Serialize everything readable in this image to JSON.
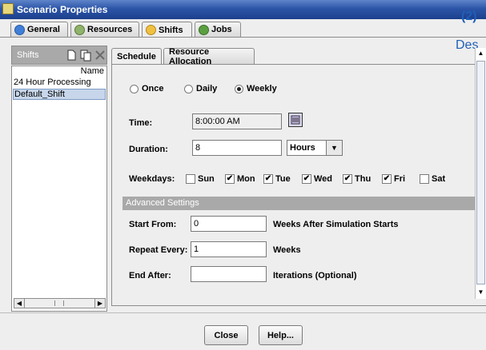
{
  "window": {
    "title": "Scenario Properties"
  },
  "overlay": {
    "number": "(2)",
    "partial_text": "Des"
  },
  "tabs": [
    {
      "label": "General"
    },
    {
      "label": "Resources"
    },
    {
      "label": "Shifts"
    },
    {
      "label": "Jobs"
    }
  ],
  "shifts_panel": {
    "header": "Shifts",
    "column_header": "Name",
    "items": [
      "24 Hour Processing",
      "Default_Shift"
    ]
  },
  "sub_tabs": [
    {
      "label": "Schedule"
    },
    {
      "label": "Resource Allocation"
    }
  ],
  "schedule": {
    "frequency_options": [
      "Once",
      "Daily",
      "Weekly"
    ],
    "selected_frequency": "Weekly",
    "time_label": "Time:",
    "time_value": "8:00:00 AM",
    "duration_label": "Duration:",
    "duration_value": "8",
    "duration_unit": "Hours",
    "weekdays_label": "Weekdays:",
    "weekdays": [
      {
        "label": "Sun",
        "checked": false
      },
      {
        "label": "Mon",
        "checked": true
      },
      {
        "label": "Tue",
        "checked": true
      },
      {
        "label": "Wed",
        "checked": true
      },
      {
        "label": "Thu",
        "checked": true
      },
      {
        "label": "Fri",
        "checked": true
      },
      {
        "label": "Sat",
        "checked": false
      }
    ]
  },
  "advanced": {
    "header": "Advanced Settings",
    "start_from_label": "Start From:",
    "start_from_value": "0",
    "start_from_suffix": "Weeks After Simulation Starts",
    "repeat_every_label": "Repeat Every:",
    "repeat_every_value": "1",
    "repeat_every_suffix": "Weeks",
    "end_after_label": "End After:",
    "end_after_value": "",
    "end_after_suffix": "Iterations (Optional)"
  },
  "buttons": {
    "close": "Close",
    "help": "Help..."
  },
  "colors": {
    "titlebar": "#2c55a8",
    "overlay_text": "#1f5fb8",
    "selection": "#c7d6ea",
    "section_header": "#a9a9a9"
  }
}
